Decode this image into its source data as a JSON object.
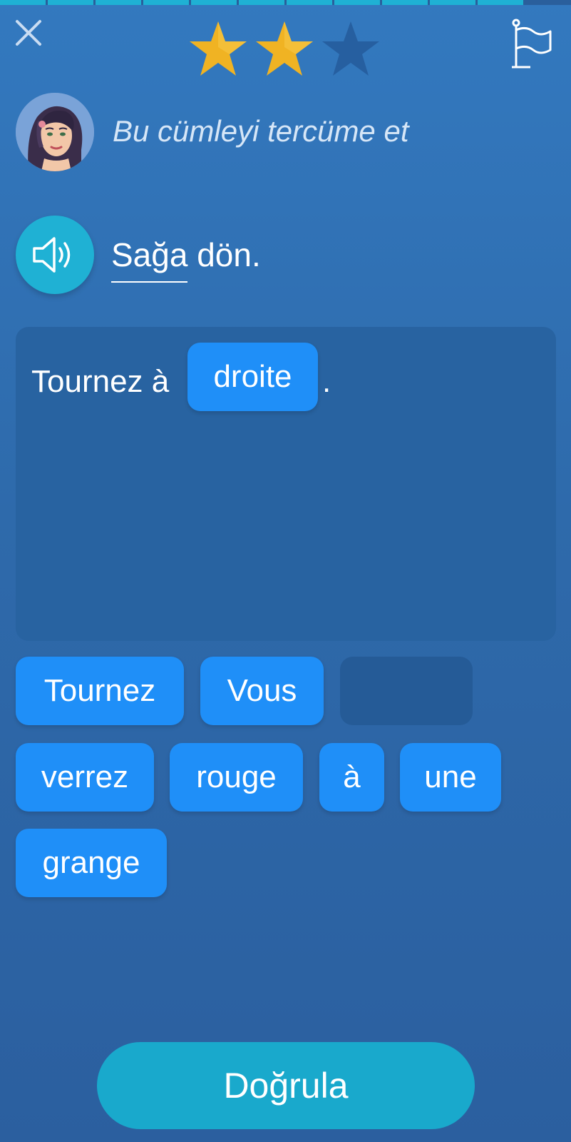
{
  "progress": {
    "segments_total": 12,
    "segments_completed": 11
  },
  "rating": {
    "stars_total": 3,
    "stars_filled": 2,
    "filled_color": "#f0b323",
    "empty_color": "#265fa0"
  },
  "header": {
    "close_icon": "close-icon",
    "flag_icon": "flag-icon"
  },
  "instruction": {
    "avatar": "tutor-avatar",
    "text": "Bu cümleyi tercüme et"
  },
  "prompt": {
    "audio_icon": "speaker-icon",
    "hint_word": "Sağa",
    "rest": "dön."
  },
  "answer": {
    "prefix": "Tournez à",
    "selected_word": "droite",
    "suffix": "."
  },
  "word_bank": [
    "Tournez",
    "Vous",
    "",
    "verrez",
    "rouge",
    "à",
    "une",
    "grange"
  ],
  "actions": {
    "verify_label": "Doğrula"
  },
  "colors": {
    "background": "#2f6eb0",
    "chip": "#1f8ff8",
    "accent": "#1fb1d4"
  }
}
